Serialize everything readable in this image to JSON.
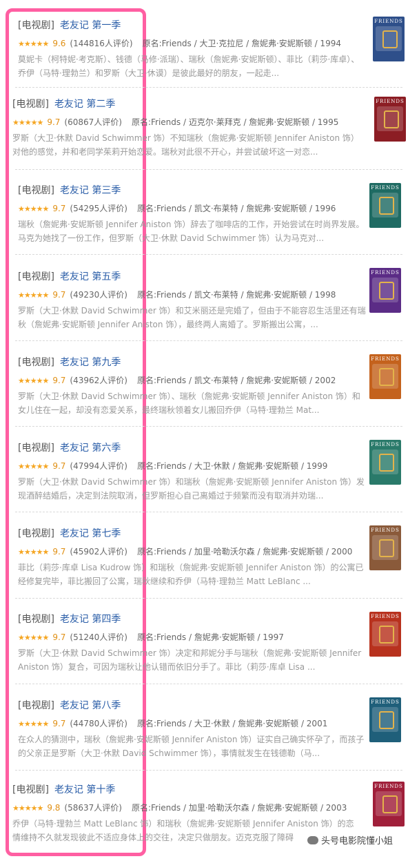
{
  "items": [
    {
      "tag": "[电视剧]",
      "title": "老友记 第一季",
      "stars": "★★★★★",
      "score": "9.6",
      "count": "(144816人评价)",
      "orig": "原名:Friends / 大卫·克拉尼 / 詹妮弗·安妮斯顿 / 1994",
      "desc": "莫妮卡（柯特妮·考克斯）、钱德（马修·派瑞）、瑞秋（詹妮弗·安妮斯顿）、菲比（莉莎·库卓）、乔伊（马特·理勃兰）和罗斯（大卫·休谟）是彼此最好的朋友，一起走...",
      "poster": "#2e4f8a"
    },
    {
      "tag": "[电视剧]",
      "title": "老友记 第二季",
      "stars": "★★★★★",
      "score": "9.7",
      "count": "(60867人评价)",
      "orig": "原名:Friends / 迈克尔·莱拜克 / 詹妮弗·安妮斯顿 / 1995",
      "desc": "罗斯（大卫·休默 David Schwimmer 饰）不知瑞秋（詹妮弗·安妮斯顿 Jennifer Aniston 饰）对他的感觉，并和老同学茱莉开始恋爱。瑞秋对此很不开心，并尝试破坏这一对恋...",
      "poster": "#8c1d24"
    },
    {
      "tag": "[电视剧]",
      "title": "老友记 第三季",
      "stars": "★★★★★",
      "score": "9.7",
      "count": "(54295人评价)",
      "orig": "原名:Friends / 凯文·布莱特 / 詹妮弗·安妮斯顿 / 1996",
      "desc": "瑞秋（詹妮弗·安妮斯顿 Jennifer Aniston 饰）辞去了咖啡店的工作，开始尝试在时尚界发展。马克为她找了一份工作，但罗斯（大卫·休默 David Schwimmer 饰）认为马克对...",
      "poster": "#1f6b63"
    },
    {
      "tag": "[电视剧]",
      "title": "老友记 第五季",
      "stars": "★★★★★",
      "score": "9.7",
      "count": "(49230人评价)",
      "orig": "原名:Friends / 凯文·布莱特 / 詹妮弗·安妮斯顿 / 1998",
      "desc": "罗斯（大卫·休默 David Schwimmer 饰）和艾米丽还是完婚了，但由于不能容忍生活里还有瑞秋（詹妮弗·安妮斯顿 Jennifer Aniston 饰），最终两人离婚了。罗斯搬出公寓，...",
      "poster": "#5b2c86"
    },
    {
      "tag": "[电视剧]",
      "title": "老友记 第九季",
      "stars": "★★★★★",
      "score": "9.7",
      "count": "(43962人评价)",
      "orig": "原名:Friends / 凯文·布莱特 / 詹妮弗·安妮斯顿 / 2002",
      "desc": "罗斯（大卫·休默 David Schwimmer 饰）、瑞秋（詹妮弗·安妮斯顿 Jennifer Aniston 饰）和女儿住在一起，却没有恋爱关系，最终瑞秋领着女儿搬回乔伊（马特·理勃兰 Mat...",
      "poster": "#c4621d"
    },
    {
      "tag": "[电视剧]",
      "title": "老友记 第六季",
      "stars": "★★★★★",
      "score": "9.7",
      "count": "(47994人评价)",
      "orig": "原名:Friends / 大卫·休默 / 詹妮弗·安妮斯顿 / 1999",
      "desc": "罗斯（大卫·休默 David Schwimmer 饰）和瑞秋（詹妮弗·安妮斯顿 Jennifer Aniston 饰）发现酒醉结婚后，决定到法院取消，但罗斯担心自己离婚过于频繁而没有取消并劝瑞...",
      "poster": "#2a7a6a"
    },
    {
      "tag": "[电视剧]",
      "title": "老友记 第七季",
      "stars": "★★★★★",
      "score": "9.7",
      "count": "(45902人评价)",
      "orig": "原名:Friends / 加里·哈勒沃尔森 / 詹妮弗·安妮斯顿 / 2000",
      "desc": "菲比（莉莎·库卓 Lisa Kudrow 饰）和瑞秋（詹妮弗·安妮斯顿 Jennifer Aniston 饰）的公寓已经修复完毕，菲比搬回了公寓，瑞秋继续和乔伊（马特·理勃兰 Matt LeBlanc ...",
      "poster": "#8a5a3a"
    },
    {
      "tag": "[电视剧]",
      "title": "老友记 第四季",
      "stars": "★★★★★",
      "score": "9.7",
      "count": "(51240人评价)",
      "orig": "原名:Friends / 詹妮弗·安妮斯顿 / 1997",
      "desc": "罗斯（大卫·休默 David Schwimmer 饰）决定和邦妮分手与瑞秋（詹妮弗·安妮斯顿 Jennifer Aniston 饰）复合，可因为瑞秋让他认错而依旧分手了。菲比（莉莎·库卓 Lisa ...",
      "poster": "#b8321e"
    },
    {
      "tag": "[电视剧]",
      "title": "老友记 第八季",
      "stars": "★★★★★",
      "score": "9.7",
      "count": "(44780人评价)",
      "orig": "原名:Friends / 大卫·休默 / 詹妮弗·安妮斯顿 / 2001",
      "desc": "在众人的猜测中，瑞秋（詹妮弗·安妮斯顿 Jennifer Aniston 饰）证实自己确实怀孕了，而孩子的父亲正是罗斯（大卫·休默 David Schwimmer 饰），事情就发生在钱德勒（马...",
      "poster": "#1f5f7a"
    },
    {
      "tag": "[电视剧]",
      "title": "老友记 第十季",
      "stars": "★★★★★",
      "score": "9.8",
      "count": "(58637人评价)",
      "orig": "原名:Friends / 加里·哈勒沃尔森 / 詹妮弗·安妮斯顿 / 2003",
      "desc": "乔伊（马特·理勃兰 Matt LeBlanc 饰）和瑞秋（詹妮弗·安妮斯顿 Jennifer Aniston 饰）的恋情维持不久就发现彼此不适应身体上的交往，决定只做朋友。迈克克服了障碍",
      "poster": "#a01f3a"
    }
  ],
  "poster_title": "FRIENDS",
  "watermark": "头号电影院懂小姐",
  "colors": {
    "highlight": "#ff5fa2",
    "link": "#2b5ea8",
    "star": "#f5a623"
  }
}
